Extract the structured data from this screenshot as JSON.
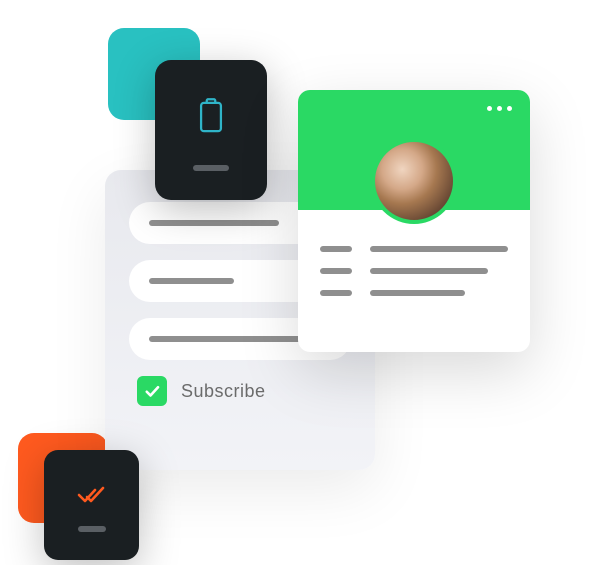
{
  "decorative": {
    "teal_square": "#29c1c1",
    "orange_square": "#ff5a1f"
  },
  "form_card": {
    "inputs": [
      {
        "placeholder_width": "medium"
      },
      {
        "placeholder_width": "short"
      },
      {
        "placeholder_width": "long"
      }
    ],
    "checkbox": {
      "checked": true,
      "label": "Subscribe"
    }
  },
  "dark_card_top": {
    "icon": "clipboard-icon",
    "icon_color": "#2fb4c8"
  },
  "dark_card_bottom": {
    "icon": "double-check-icon",
    "icon_color": "#ff5a1f"
  },
  "profile_card": {
    "accent": "#2ad964",
    "menu_icon": "more-dots-icon",
    "avatar": "user-avatar",
    "detail_rows": 3
  }
}
